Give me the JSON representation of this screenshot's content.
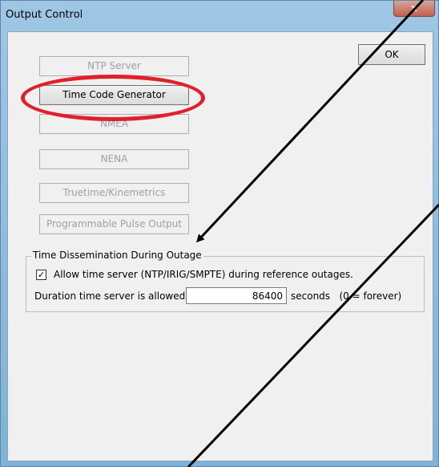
{
  "window": {
    "title": "Output Control",
    "close_label": "x"
  },
  "buttons": {
    "ntp_server": "NTP Server",
    "time_code_generator": "Time Code Generator",
    "nmea": "NMEA",
    "nena": "NENA",
    "truetime": "Truetime/Kinemetrics",
    "programmable_pulse": "Programmable Pulse Output",
    "ok": "OK"
  },
  "group": {
    "title": "Time Dissemination During Outage",
    "checkbox_checked": true,
    "checkbox_mark": "✓",
    "checkbox_label": "Allow time server (NTP/IRIG/SMPTE) during reference outages.",
    "duration_label": "Duration time server is allowed:",
    "duration_value": "86400",
    "duration_suffix": "seconds   (0 = forever)"
  },
  "annotation": {
    "highlight_color": "#e0202a",
    "arrow_color": "#000000"
  }
}
